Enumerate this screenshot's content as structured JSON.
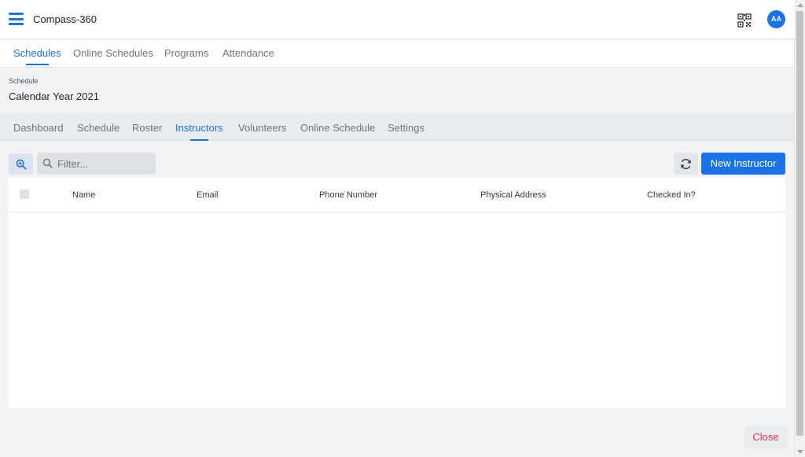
{
  "app": {
    "title": "Compass-360",
    "user_initials": "AA"
  },
  "primary_tabs": [
    {
      "label": "Schedules",
      "active": true
    },
    {
      "label": "Online Schedules",
      "active": false
    },
    {
      "label": "Programs",
      "active": false
    },
    {
      "label": "Attendance",
      "active": false
    }
  ],
  "schedule": {
    "label": "Schedule",
    "value": "Calendar Year 2021"
  },
  "secondary_tabs": [
    {
      "label": "Dashboard",
      "active": false
    },
    {
      "label": "Schedule",
      "active": false
    },
    {
      "label": "Roster",
      "active": false
    },
    {
      "label": "Instructors",
      "active": true
    },
    {
      "label": "Volunteers",
      "active": false
    },
    {
      "label": "Online Schedule",
      "active": false
    },
    {
      "label": "Settings",
      "active": false
    }
  ],
  "toolbar": {
    "filter_placeholder": "Filter...",
    "filter_value": "",
    "new_button": "New Instructor"
  },
  "table": {
    "columns": [
      "Name",
      "Email",
      "Phone Number",
      "Physical Address",
      "Checked In?"
    ],
    "rows": []
  },
  "footer": {
    "close_label": "Close"
  },
  "icons": {
    "menu": "hamburger-menu-icon",
    "qr": "qr-code-icon",
    "zoom": "zoom-in-icon",
    "search": "search-icon",
    "refresh": "refresh-icon"
  },
  "colors": {
    "accent": "#1a73e8",
    "danger": "#dc3545"
  }
}
